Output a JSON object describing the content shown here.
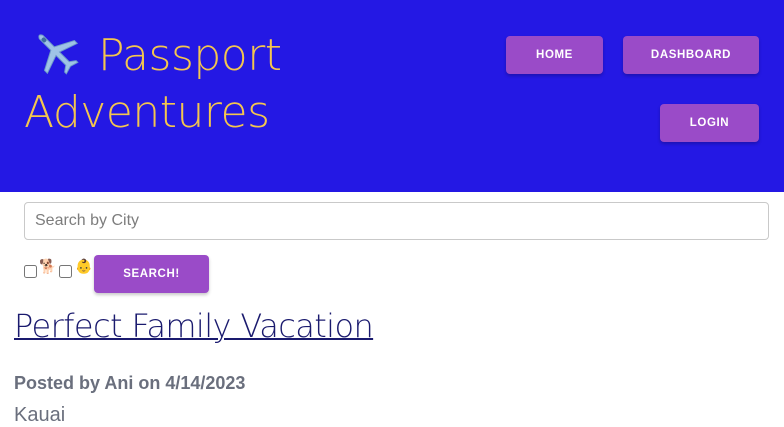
{
  "header": {
    "brand_line1": "Passport",
    "brand_line2": "Adventures",
    "brand_icon": "airplane-icon",
    "colors": {
      "background": "#2418e4",
      "brand_text": "#f4c64e",
      "button": "#9a4bc8"
    }
  },
  "nav": {
    "home": "HOME",
    "dashboard": "DASHBOARD",
    "login": "LOGIN"
  },
  "search": {
    "placeholder": "Search by City",
    "value": "",
    "filters": [
      {
        "icon": "dog-icon",
        "glyph": "🐕",
        "checked": false
      },
      {
        "icon": "baby-icon",
        "glyph": "👶",
        "checked": false
      }
    ],
    "button_label": "SEARCH!"
  },
  "posts": [
    {
      "title": "Perfect Family Vacation",
      "meta": "Posted by Ani on 4/14/2023",
      "city": "Kauai"
    }
  ]
}
